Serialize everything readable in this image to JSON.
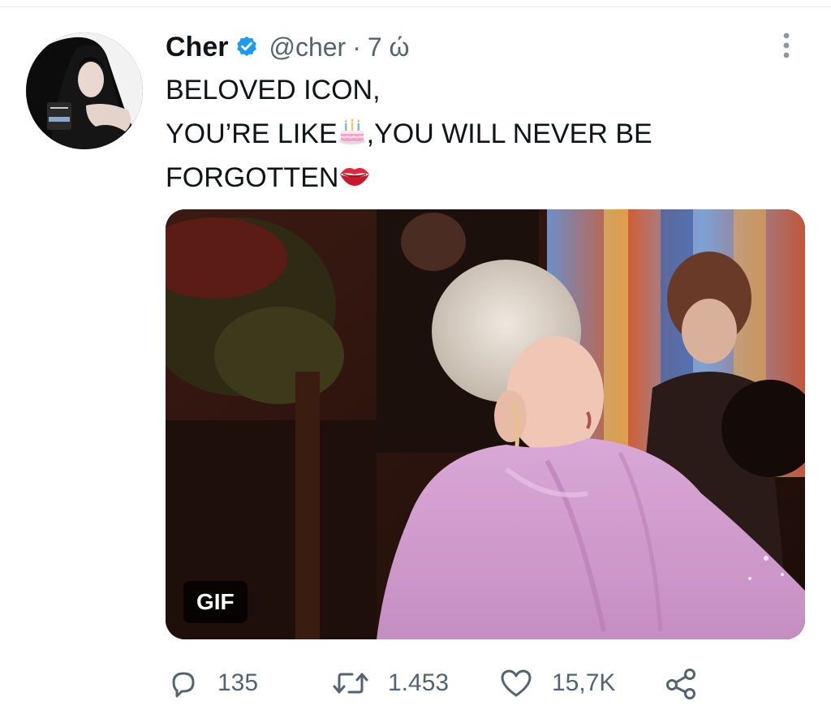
{
  "tweet": {
    "author": {
      "display_name": "Cher",
      "handle": "@cher",
      "verified": true
    },
    "separator": "·",
    "time": "7 ώ",
    "text_lines": [
      "BELOVED ICON,",
      "YOU’RE LIKE",
      ",YOU WILL NEVER BE",
      "FORGOTTEN"
    ],
    "emojis": {
      "birthday_cake": "🎂",
      "kiss_mark": "💋"
    },
    "media": {
      "badge": "GIF"
    },
    "actions": {
      "reply_count": "135",
      "retweet_count": "1.453",
      "like_count": "15,7K"
    },
    "icons": {
      "verified": "verified-badge-icon",
      "more": "more-vertical-icon",
      "reply": "reply-icon",
      "retweet": "retweet-icon",
      "like": "heart-icon",
      "share": "share-icon"
    },
    "colors": {
      "verified_blue": "#1d9bf0",
      "muted_text": "#536471",
      "primary_text": "#0f1419"
    }
  }
}
